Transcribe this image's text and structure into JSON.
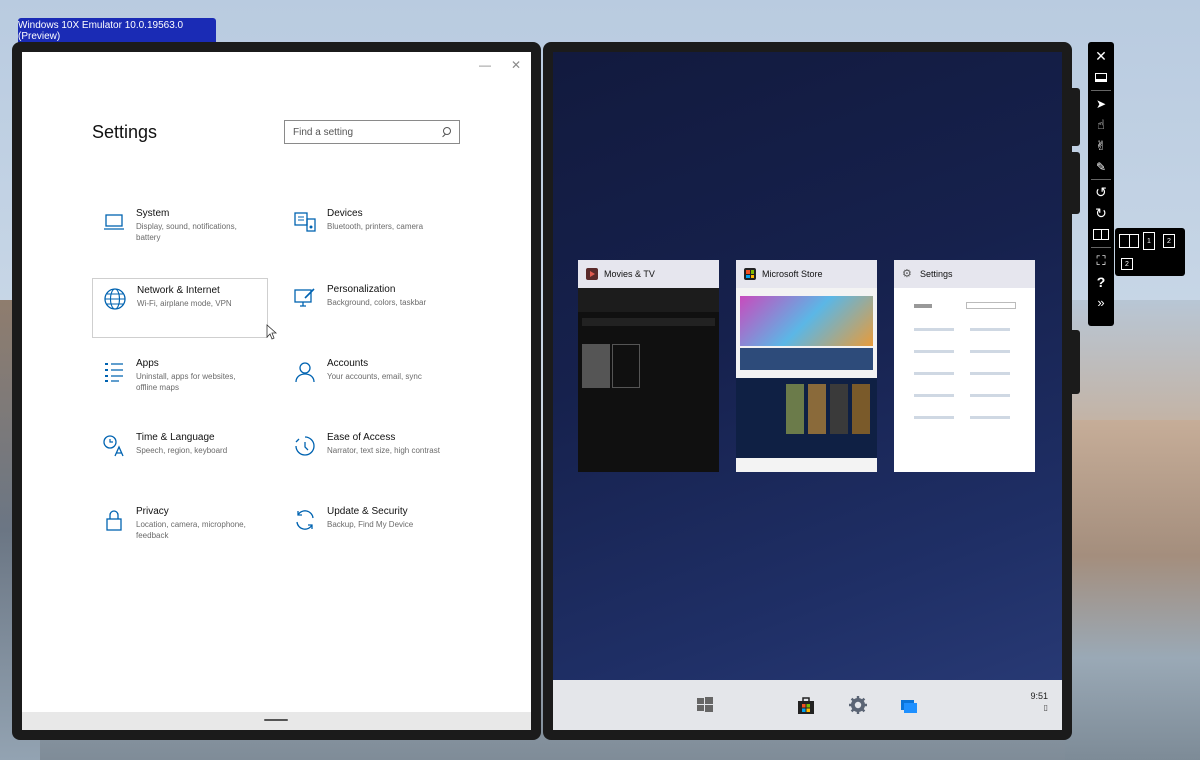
{
  "emulator": {
    "title": "Windows 10X Emulator 10.0.19563.0 (Preview)"
  },
  "settings": {
    "title": "Settings",
    "window_controls": {
      "minimize": "—",
      "close": "✕"
    },
    "search": {
      "placeholder": "Find a setting"
    },
    "tiles": [
      {
        "name": "System",
        "desc": "Display, sound, notifications, battery",
        "icon": "laptop-icon"
      },
      {
        "name": "Devices",
        "desc": "Bluetooth, printers, camera",
        "icon": "devices-icon"
      },
      {
        "name": "Network & Internet",
        "desc": "Wi-Fi, airplane mode, VPN",
        "icon": "globe-icon"
      },
      {
        "name": "Personalization",
        "desc": "Background, colors, taskbar",
        "icon": "paint-icon"
      },
      {
        "name": "Apps",
        "desc": "Uninstall, apps for websites, offline maps",
        "icon": "apps-list-icon"
      },
      {
        "name": "Accounts",
        "desc": "Your accounts, email, sync",
        "icon": "person-icon"
      },
      {
        "name": "Time & Language",
        "desc": "Speech, region, keyboard",
        "icon": "time-language-icon"
      },
      {
        "name": "Ease of Access",
        "desc": "Narrator, text size, high contrast",
        "icon": "ease-of-access-icon"
      },
      {
        "name": "Privacy",
        "desc": "Location, camera, microphone, feedback",
        "icon": "lock-icon"
      },
      {
        "name": "Update & Security",
        "desc": "Backup, Find My Device",
        "icon": "sync-icon"
      }
    ]
  },
  "taskview": {
    "cards": [
      {
        "title": "Movies & TV",
        "icon": "movies-icon"
      },
      {
        "title": "Microsoft Store",
        "icon": "store-icon"
      },
      {
        "title": "Settings",
        "icon": "gear-icon"
      }
    ]
  },
  "taskbar": {
    "icons": [
      "windows-logo-icon",
      "store-icon",
      "gear-icon",
      "task-view-icon"
    ],
    "time": "9:51"
  },
  "toolbar": {
    "tools": [
      "close-icon",
      "minimize-icon",
      "pointer-icon",
      "single-touch-icon",
      "multi-touch-icon",
      "pen-icon",
      "rotate-left-icon",
      "rotate-right-icon",
      "posture-icon",
      "fit-screen-icon",
      "help-icon",
      "more-icon"
    ],
    "mode_labels": [
      "1",
      "2",
      "2"
    ]
  },
  "colors": {
    "accent": "#0063b1",
    "emulator_tab": "#1a2bb5",
    "taskview_bg": "#16214d"
  }
}
